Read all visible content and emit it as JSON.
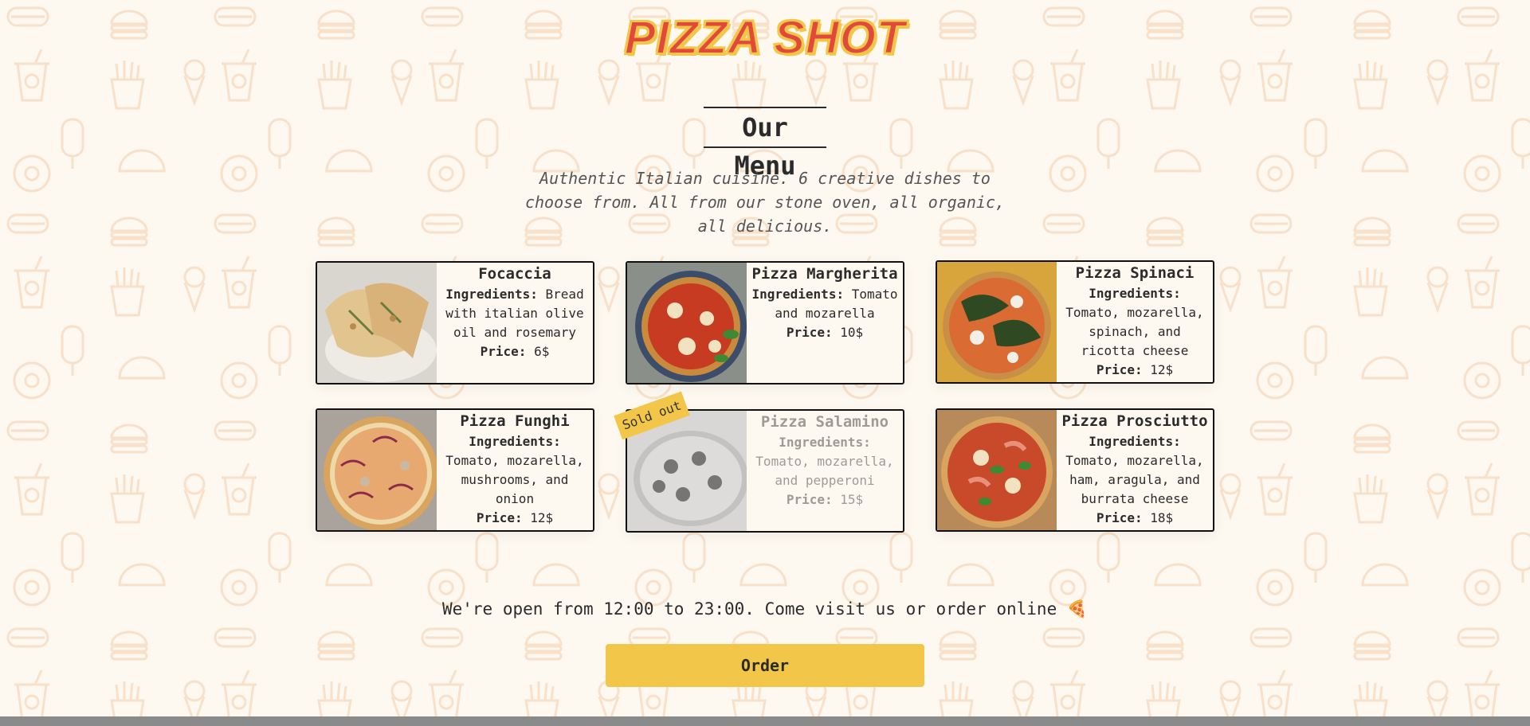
{
  "header": {
    "logo_text": "PIZZA SHOT"
  },
  "menu": {
    "title": "Our Menu",
    "intro": "Authentic Italian cuisine. 6 creative dishes to choose from. All from our stone oven, all organic, all delicious.",
    "ingredients_label": "Ingredients:",
    "price_label": "Price:",
    "items": [
      {
        "name": "Focaccia",
        "ingredients": "Bread with italian olive oil and rosemary",
        "price": "6$",
        "sold_out": false,
        "photo": "focaccia-photo"
      },
      {
        "name": "Pizza Margherita",
        "ingredients": "Tomato and mozarella",
        "price": "10$",
        "sold_out": false,
        "photo": "margherita-photo"
      },
      {
        "name": "Pizza Spinaci",
        "ingredients": "Tomato, mozarella, spinach, and ricotta cheese",
        "price": "12$",
        "sold_out": false,
        "photo": "spinaci-photo"
      },
      {
        "name": "Pizza Funghi",
        "ingredients": "Tomato, mozarella, mushrooms, and onion",
        "price": "12$",
        "sold_out": false,
        "photo": "funghi-photo"
      },
      {
        "name": "Pizza Salamino",
        "ingredients": "Tomato, mozarella, and pepperoni",
        "price": "15$",
        "sold_out": true,
        "badge": "Sold out",
        "photo": "salamino-photo"
      },
      {
        "name": "Pizza Prosciutto",
        "ingredients": "Tomato, mozarella, ham, aragula, and burrata cheese",
        "price": "18$",
        "sold_out": false,
        "photo": "prosciutto-photo"
      }
    ]
  },
  "footer": {
    "hours_text": "We're open from 12:00 to 23:00. Come visit us or order online 🍕",
    "order_label": "Order"
  },
  "colors": {
    "background": "#fdf8f0",
    "accent_yellow": "#f2c649",
    "logo_red": "#e14a3a",
    "text": "#2b2b2b"
  }
}
